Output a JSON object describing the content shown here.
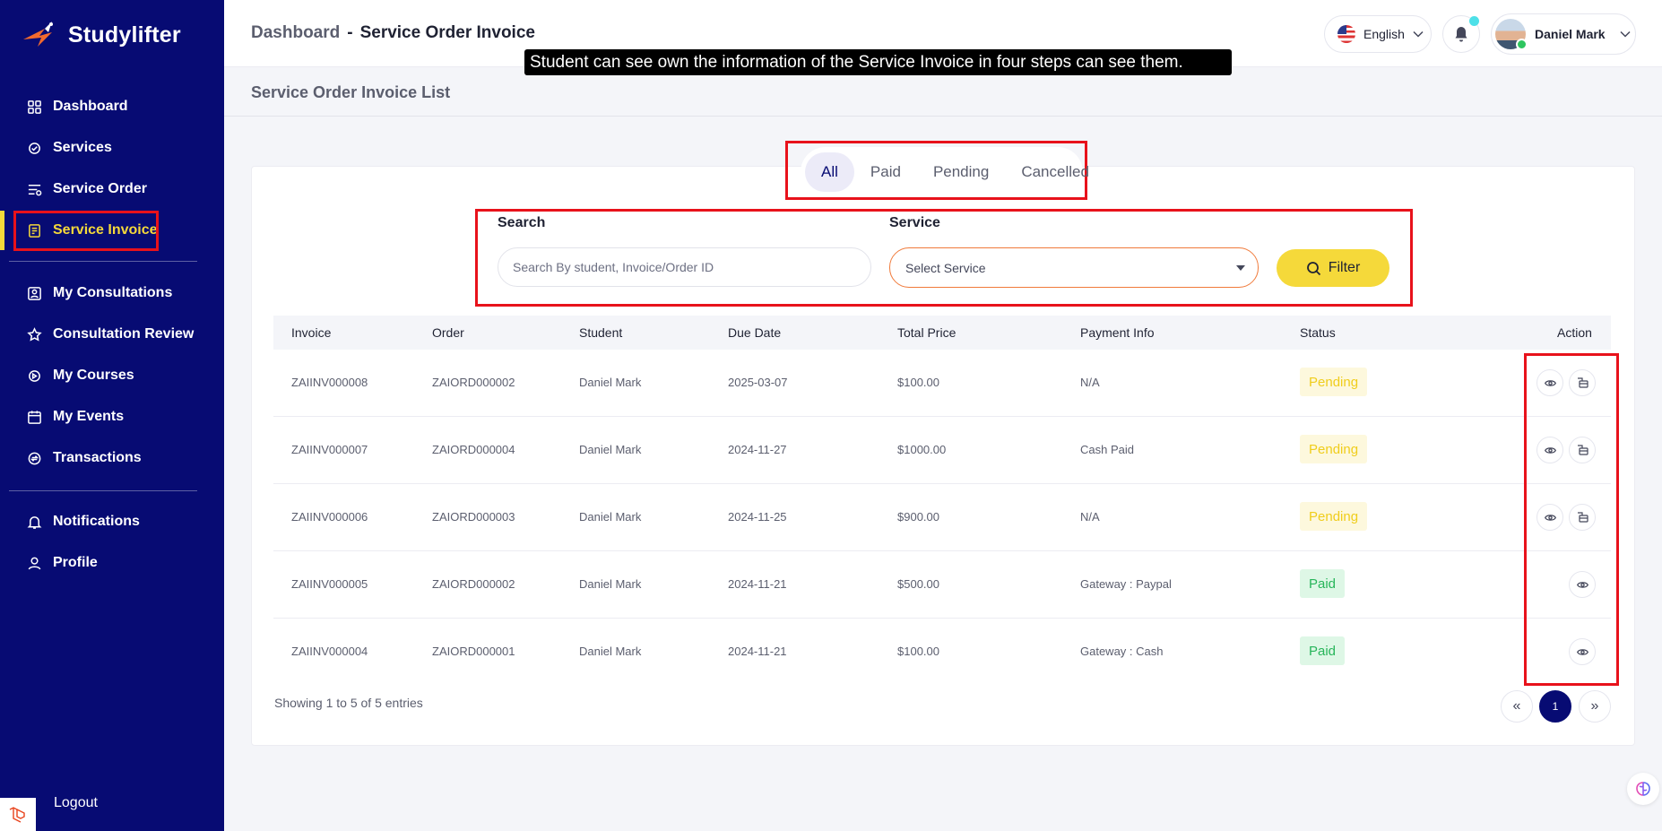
{
  "app": {
    "name": "Studylifter"
  },
  "sidebar": {
    "items": [
      {
        "label": "Dashboard",
        "icon": "dashboard-icon"
      },
      {
        "label": "Services",
        "icon": "services-icon"
      },
      {
        "label": "Service Order",
        "icon": "service-order-icon"
      },
      {
        "label": "Service Invoice",
        "icon": "invoice-icon",
        "active": true
      },
      {
        "label": "My Consultations",
        "icon": "consultation-icon"
      },
      {
        "label": "Consultation Review",
        "icon": "star-icon"
      },
      {
        "label": "My Courses",
        "icon": "courses-icon"
      },
      {
        "label": "My Events",
        "icon": "events-icon"
      },
      {
        "label": "Transactions",
        "icon": "transactions-icon"
      },
      {
        "label": "Notifications",
        "icon": "bell-icon"
      },
      {
        "label": "Profile",
        "icon": "user-icon"
      }
    ],
    "logout": "Logout"
  },
  "header": {
    "breadcrumb_parent": "Dashboard",
    "breadcrumb_separator": "-",
    "breadcrumb_current": "Service Order Invoice",
    "language": "English",
    "user_name": "Daniel Mark"
  },
  "tooltip": "Student can see own the information of the Service Invoice in four steps can see them.",
  "page_title": "Service Order Invoice List",
  "tabs": [
    "All",
    "Paid",
    "Pending",
    "Cancelled"
  ],
  "filters": {
    "search_label": "Search",
    "search_placeholder": "Search By student, Invoice/Order ID",
    "service_label": "Service",
    "service_selected": "Select Service",
    "filter_button": "Filter"
  },
  "table": {
    "columns": [
      "Invoice",
      "Order",
      "Student",
      "Due Date",
      "Total Price",
      "Payment Info",
      "Status",
      "Action"
    ],
    "rows": [
      {
        "invoice": "ZAIINV000008",
        "order": "ZAIORD000002",
        "student": "Daniel Mark",
        "due_date": "2025-03-07",
        "total": "$100.00",
        "payment": "N/A",
        "status": "Pending"
      },
      {
        "invoice": "ZAIINV000007",
        "order": "ZAIORD000004",
        "student": "Daniel Mark",
        "due_date": "2024-11-27",
        "total": "$1000.00",
        "payment": "Cash Paid",
        "status": "Pending"
      },
      {
        "invoice": "ZAIINV000006",
        "order": "ZAIORD000003",
        "student": "Daniel Mark",
        "due_date": "2024-11-25",
        "total": "$900.00",
        "payment": "N/A",
        "status": "Pending"
      },
      {
        "invoice": "ZAIINV000005",
        "order": "ZAIORD000002",
        "student": "Daniel Mark",
        "due_date": "2024-11-21",
        "total": "$500.00",
        "payment": "Gateway : Paypal",
        "status": "Paid"
      },
      {
        "invoice": "ZAIINV000004",
        "order": "ZAIORD000001",
        "student": "Daniel Mark",
        "due_date": "2024-11-21",
        "total": "$100.00",
        "payment": "Gateway : Cash",
        "status": "Paid"
      }
    ],
    "entries_text": "Showing 1 to 5 of 5 entries"
  },
  "pagination": {
    "prev": "«",
    "current": "1",
    "next": "»"
  },
  "colors": {
    "sidebar": "#070b73",
    "accent": "#f5d93a",
    "highlight": "#e8121b",
    "pending": "#f0cd1c",
    "paid": "#27b55a"
  }
}
